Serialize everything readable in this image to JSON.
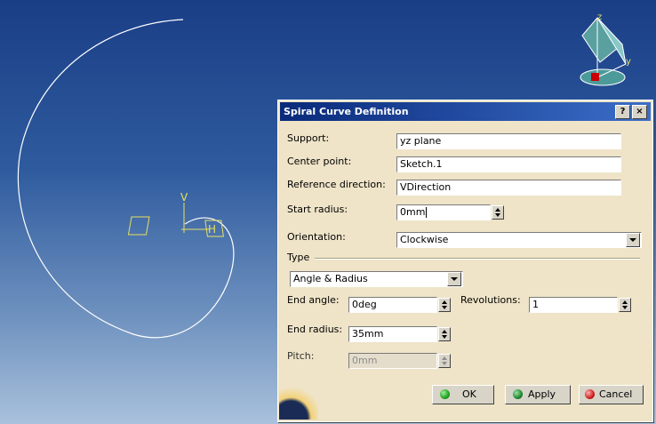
{
  "compass": {
    "axis_z": "z",
    "axis_y": "y"
  },
  "sketch_axes": {
    "v_label": "V",
    "h_label": "H"
  },
  "dialog": {
    "title": "Spiral Curve Definition",
    "help_glyph": "?",
    "close_glyph": "×",
    "support": {
      "label": "Support:",
      "value": "yz plane"
    },
    "center_point": {
      "label": "Center point:",
      "value": "Sketch.1"
    },
    "reference_direction": {
      "label": "Reference direction:",
      "value": "VDirection"
    },
    "start_radius": {
      "label": "Start radius:",
      "value": "0mm"
    },
    "orientation": {
      "label": "Orientation:",
      "value": "Clockwise"
    },
    "type": {
      "group_label": "Type",
      "selected": "Angle & Radius",
      "end_angle": {
        "label": "End angle:",
        "value": "0deg"
      },
      "revolutions": {
        "label": "Revolutions:",
        "value": "1"
      },
      "end_radius": {
        "label": "End radius:",
        "value": "35mm"
      },
      "pitch": {
        "label": "Pitch:",
        "value": "0mm",
        "enabled": false
      }
    },
    "buttons": {
      "ok": "OK",
      "apply": "Apply",
      "cancel": "Cancel"
    }
  },
  "colors": {
    "dialog_bg": "#efe4c8",
    "title_bar": "#0a2a7a",
    "ok_dot": "#1fa31f",
    "apply_dot": "#1f8a2f",
    "cancel_dot": "#d02020"
  }
}
